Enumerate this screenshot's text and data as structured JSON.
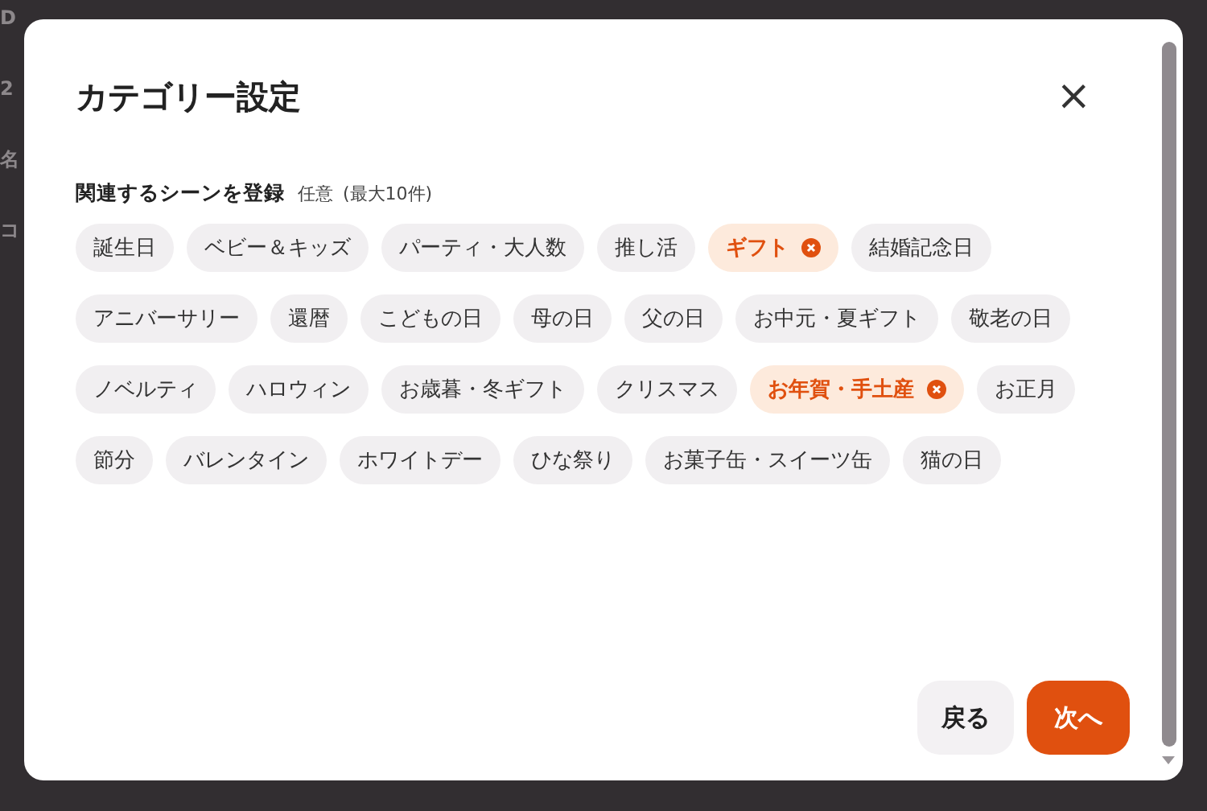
{
  "background_fragments": [
    "D",
    "2",
    "名",
    "コ"
  ],
  "dialog": {
    "title": "カテゴリー設定",
    "close": "×",
    "section_label": "関連するシーンを登録",
    "optional": "任意",
    "limit": "(最大10件)",
    "chips": [
      {
        "label": "誕生日",
        "selected": false
      },
      {
        "label": "ベビー＆キッズ",
        "selected": false
      },
      {
        "label": "パーティ・大人数",
        "selected": false
      },
      {
        "label": "推し活",
        "selected": false
      },
      {
        "label": "ギフト",
        "selected": true
      },
      {
        "label": "結婚記念日",
        "selected": false
      },
      {
        "label": "アニバーサリー",
        "selected": false
      },
      {
        "label": "還暦",
        "selected": false
      },
      {
        "label": "こどもの日",
        "selected": false
      },
      {
        "label": "母の日",
        "selected": false
      },
      {
        "label": "父の日",
        "selected": false
      },
      {
        "label": "お中元・夏ギフト",
        "selected": false
      },
      {
        "label": "敬老の日",
        "selected": false
      },
      {
        "label": "ノベルティ",
        "selected": false
      },
      {
        "label": "ハロウィン",
        "selected": false
      },
      {
        "label": "お歳暮・冬ギフト",
        "selected": false
      },
      {
        "label": "クリスマス",
        "selected": false
      },
      {
        "label": "お年賀・手土産",
        "selected": true
      },
      {
        "label": "お正月",
        "selected": false
      },
      {
        "label": "節分",
        "selected": false
      },
      {
        "label": "バレンタイン",
        "selected": false
      },
      {
        "label": "ホワイトデー",
        "selected": false
      },
      {
        "label": "ひな祭り",
        "selected": false
      },
      {
        "label": "お菓子缶・スイーツ缶",
        "selected": false
      },
      {
        "label": "猫の日",
        "selected": false
      }
    ],
    "buttons": [
      {
        "label": "戻る",
        "kind": "secondary"
      },
      {
        "label": "次へ",
        "kind": "primary"
      }
    ]
  }
}
